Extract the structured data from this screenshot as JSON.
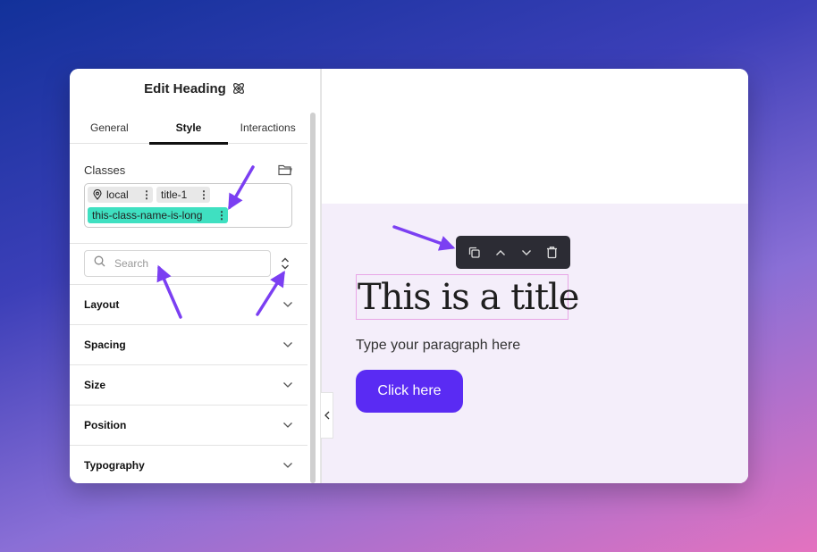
{
  "panel": {
    "title": "Edit Heading",
    "tabs": [
      {
        "label": "General"
      },
      {
        "label": "Style"
      },
      {
        "label": "Interactions"
      }
    ],
    "classes": {
      "label": "Classes",
      "chips": [
        {
          "label": "local"
        },
        {
          "label": "title-1"
        },
        {
          "label": "this-class-name-is-long"
        }
      ]
    },
    "search": {
      "placeholder": "Search",
      "value": ""
    },
    "sections": [
      {
        "label": "Layout"
      },
      {
        "label": "Spacing"
      },
      {
        "label": "Size"
      },
      {
        "label": "Position"
      },
      {
        "label": "Typography"
      }
    ]
  },
  "canvas": {
    "heading": "This is a title",
    "paragraph": "Type your paragraph here",
    "button_label": "Click here"
  },
  "colors": {
    "accent": "#5a2bf3",
    "chip_highlight": "#3fe0c1",
    "toolbar_bg": "#2c2c34",
    "stage_bg": "#f4eefa",
    "annotation_arrow": "#7b3ff2"
  },
  "icons": {
    "title": "atom-icon",
    "classes": "folder-icon",
    "chip_local": "location-pin-icon",
    "search": "search-icon",
    "sort": "sort-icon",
    "sections": "chevron-down-icon",
    "toolbar": [
      "duplicate-icon",
      "move-up-icon",
      "move-down-icon",
      "trash-icon"
    ],
    "collapse": "chevron-left-icon"
  }
}
